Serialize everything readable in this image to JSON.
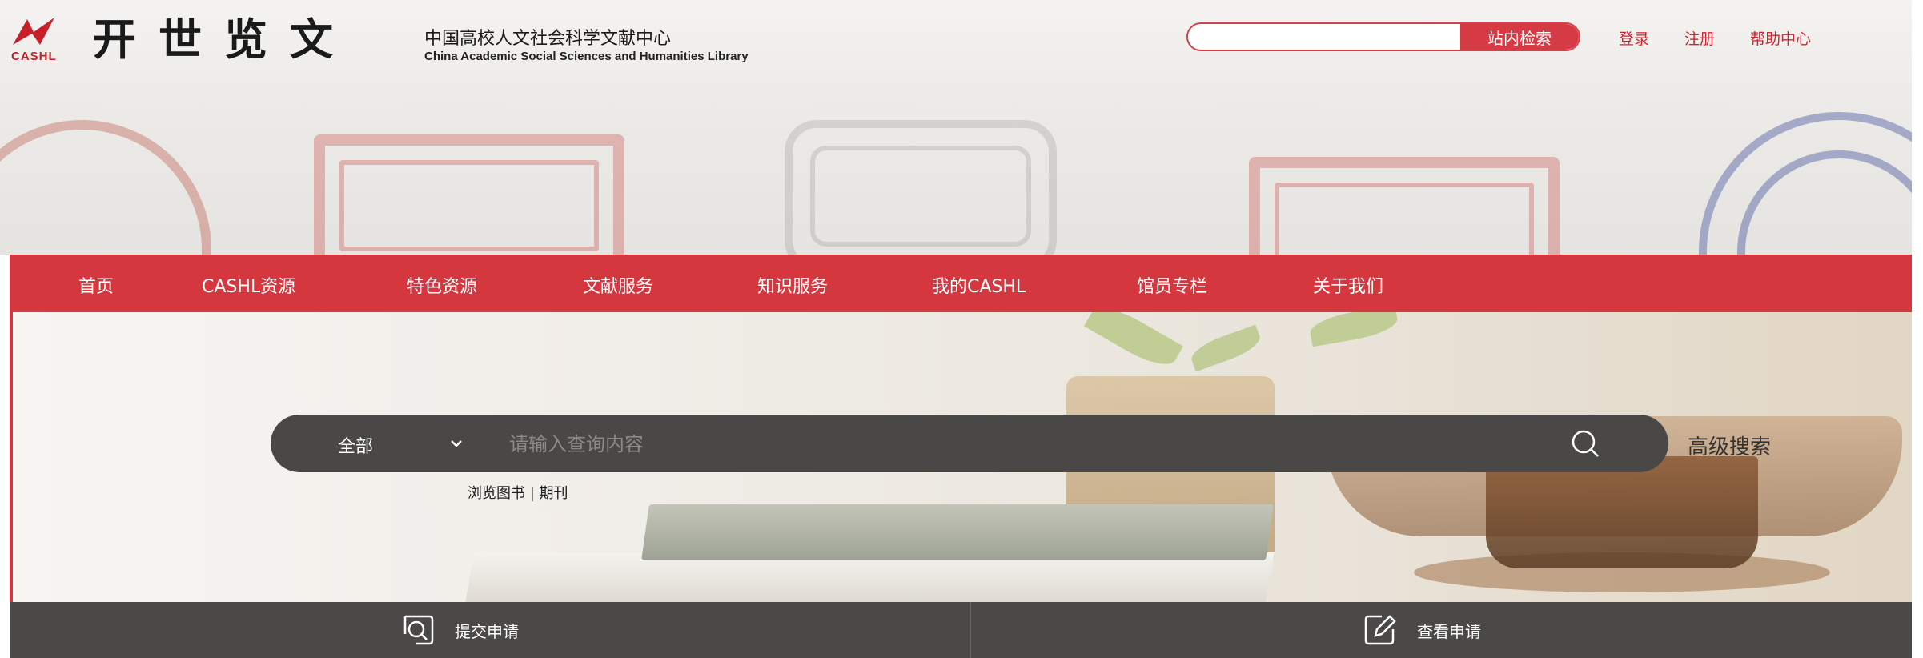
{
  "brand": {
    "logo_tag": "CASHL",
    "name_cn": "开世览文",
    "org_cn": "中国高校人文社会科学文献中心",
    "org_en": "China Academic Social Sciences and Humanities Library"
  },
  "header": {
    "site_search": {
      "value": "",
      "button_label": "站内检索"
    },
    "links": [
      "登录",
      "注册",
      "帮助中心"
    ]
  },
  "nav": {
    "items": [
      "首页",
      "CASHL资源",
      "特色资源",
      "文献服务",
      "知识服务",
      "我的CASHL",
      "馆员专栏",
      "关于我们"
    ]
  },
  "search": {
    "scope_selected": "全部",
    "placeholder": "请输入查询内容",
    "advanced_label": "高级搜索",
    "browse_books": "浏览图书",
    "separator": " | ",
    "browse_journals": "期刊"
  },
  "services": {
    "submit_label": "提交申请",
    "view_label": "查看申请"
  },
  "colors": {
    "accent_red": "#d5373f",
    "dark_bar": "#4b4948",
    "search_bar": "#4a4846"
  },
  "icons": {
    "logo": "cashl-logo-icon",
    "search": "search-icon",
    "dropdown": "chevron-down-icon",
    "submit": "search-document-icon",
    "view": "edit-document-icon"
  }
}
